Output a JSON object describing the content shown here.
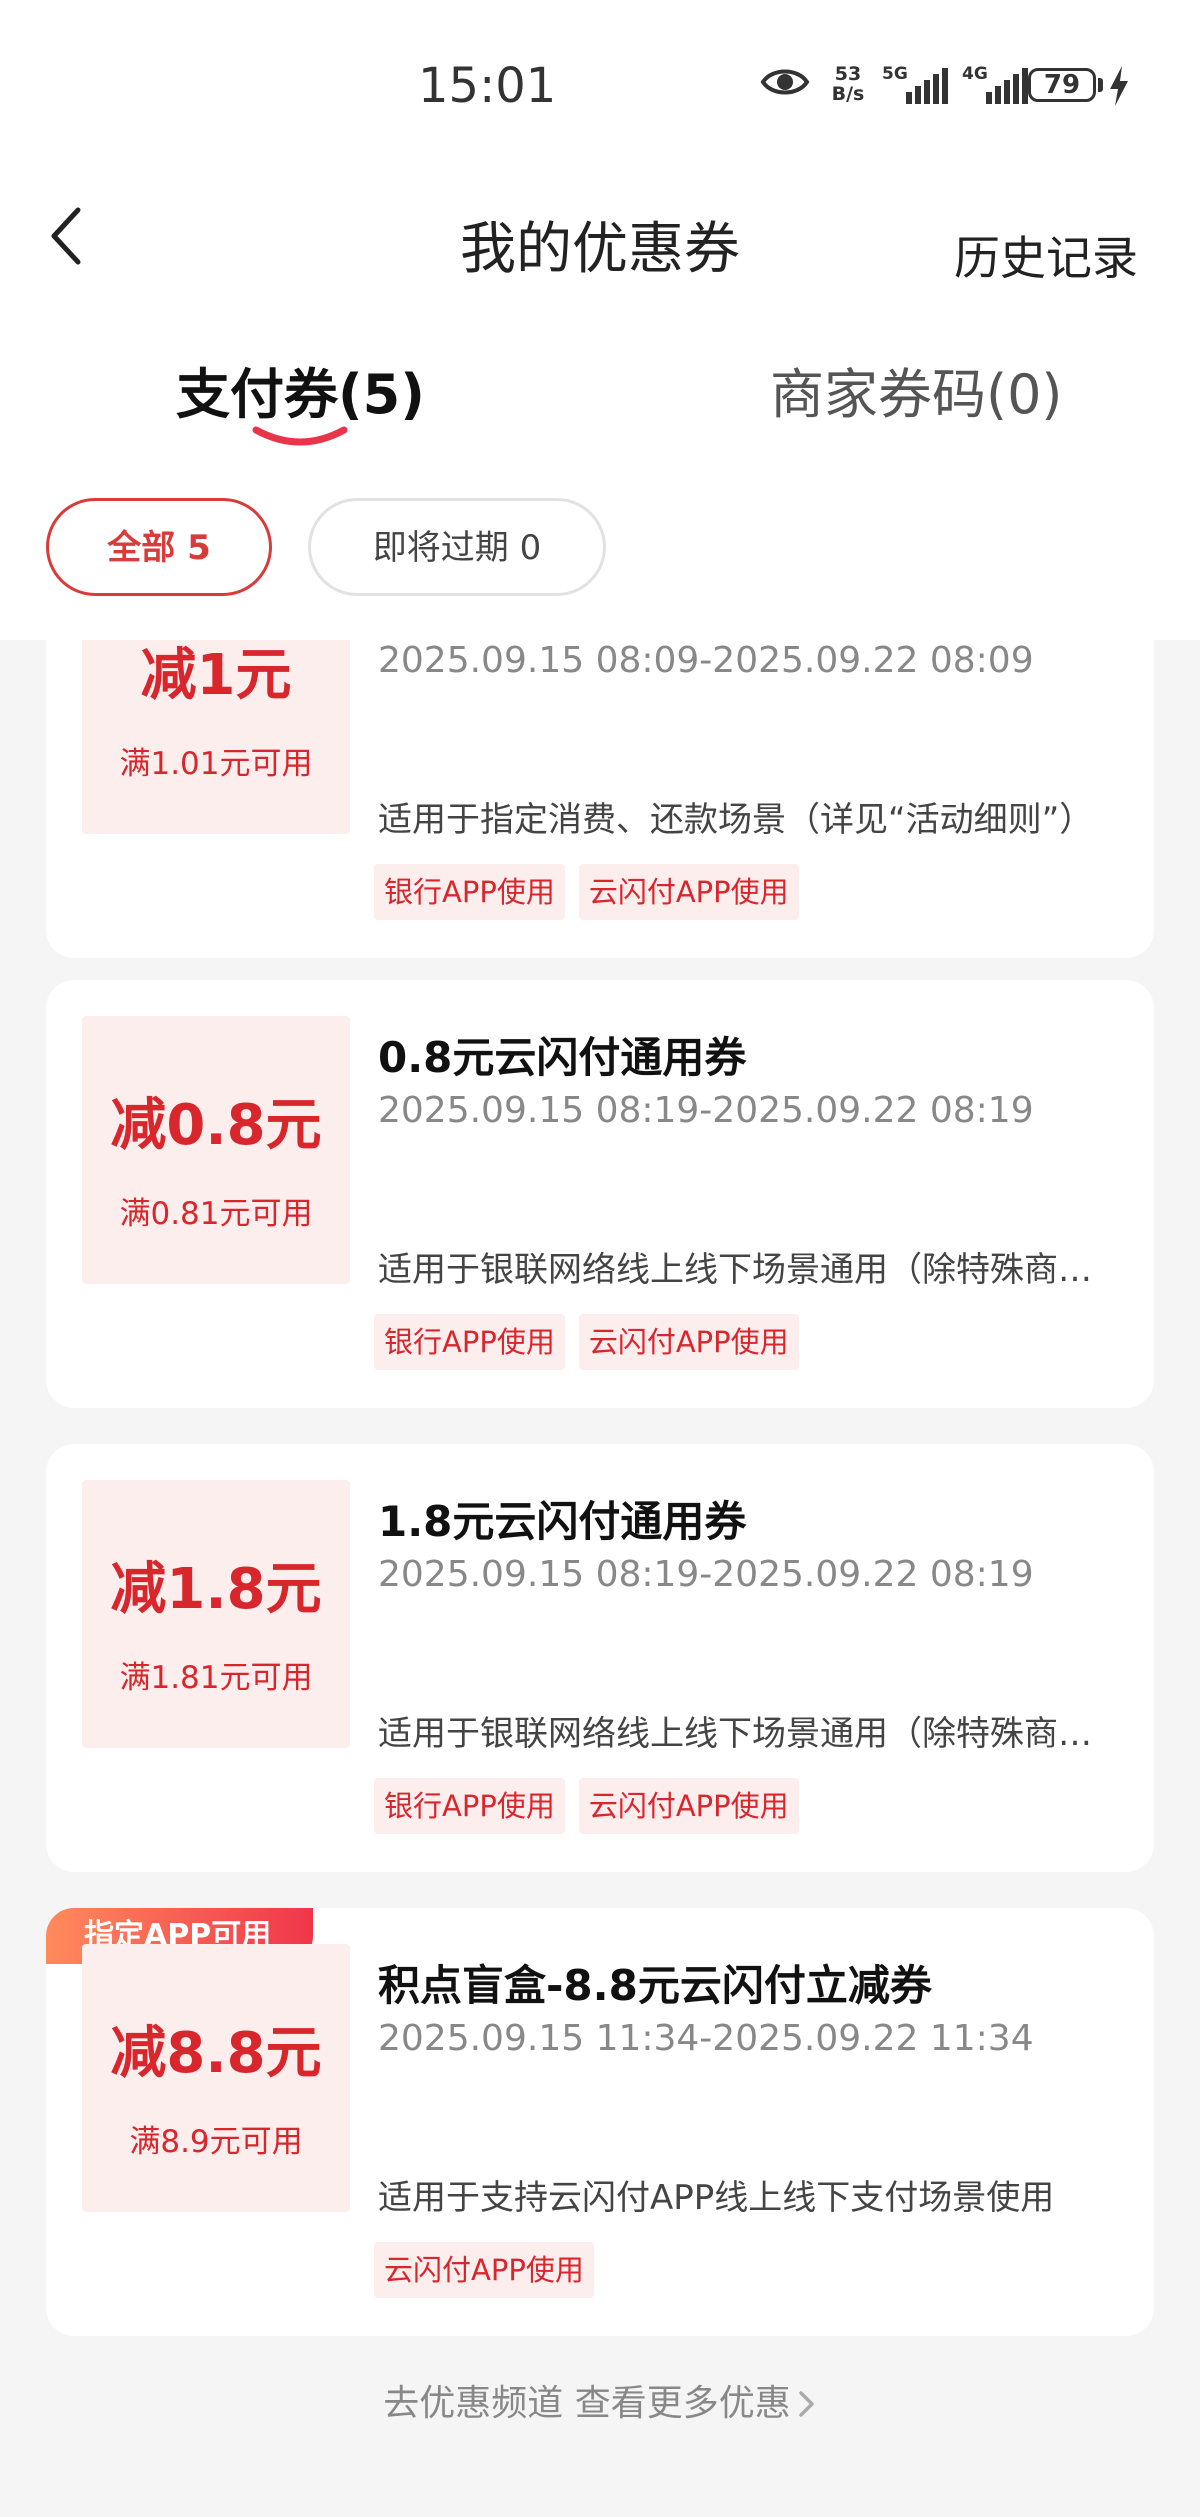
{
  "status_bar": {
    "time": "15:01",
    "net_speed": "53 B/s",
    "signal_1": "5G",
    "signal_2": "4G",
    "battery": "79"
  },
  "header": {
    "title": "我的优惠券",
    "history": "历史记录"
  },
  "tabs": [
    {
      "label": "支付券(5)"
    },
    {
      "label": "商家券码(0)"
    }
  ],
  "filters": [
    {
      "label": "全部 5"
    },
    {
      "label": "即将过期 0"
    }
  ],
  "coupons": [
    {
      "ribbon": "",
      "amount": "减1元",
      "condition": "满1.01元可用",
      "name": "",
      "validity": "2025.09.15 08:09-2025.09.22 08:09",
      "description": "适用于指定消费、还款场景（详见“活动细则”）",
      "tags": [
        "银行APP使用",
        "云闪付APP使用"
      ]
    },
    {
      "ribbon": "",
      "amount": "减0.8元",
      "condition": "满0.81元可用",
      "name": "0.8元云闪付通用券",
      "validity": "2025.09.15 08:19-2025.09.22 08:19",
      "description": "适用于银联网络线上线下场景通用（除特殊商户外）",
      "tags": [
        "银行APP使用",
        "云闪付APP使用"
      ]
    },
    {
      "ribbon": "",
      "amount": "减1.8元",
      "condition": "满1.81元可用",
      "name": "1.8元云闪付通用券",
      "validity": "2025.09.15 08:19-2025.09.22 08:19",
      "description": "适用于银联网络线上线下场景通用（除特殊商户外）",
      "tags": [
        "银行APP使用",
        "云闪付APP使用"
      ]
    },
    {
      "ribbon": "指定APP可用",
      "amount": "减8.8元",
      "condition": "满8.9元可用",
      "name": "积点盲盒-8.8元云闪付立减券",
      "validity": "2025.09.15 11:34-2025.09.22 11:34",
      "description": "适用于支持云闪付APP线上线下支付场景使用",
      "tags": [
        "云闪付APP使用"
      ]
    }
  ],
  "footer": {
    "link": "去优惠频道 查看更多优惠"
  },
  "colors": {
    "accent": "#d8262d",
    "chip_border": "#d93a3a",
    "coupon_bg": "#fdeeee",
    "page_bg": "#f5f5f5"
  },
  "icons": [
    "eye-icon",
    "signal-icon",
    "battery-icon",
    "bolt-icon",
    "back-icon",
    "chevron-right-icon"
  ]
}
